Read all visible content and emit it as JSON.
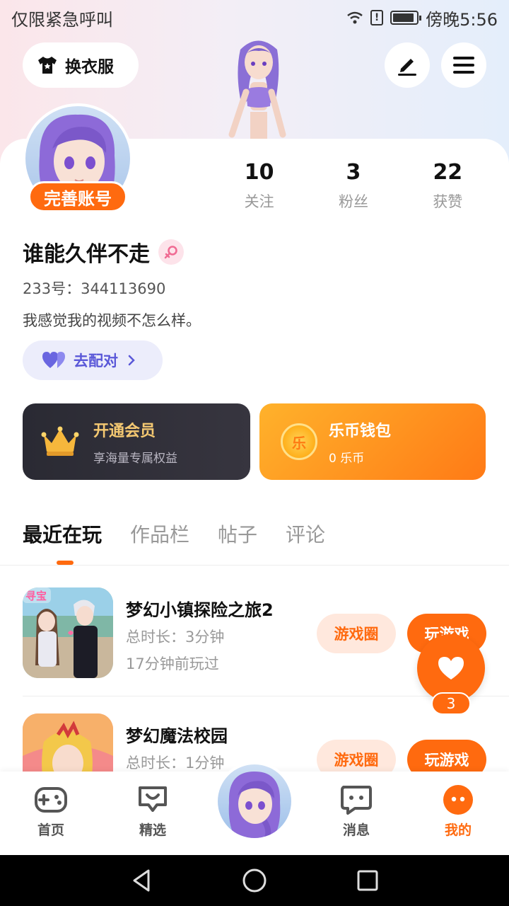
{
  "status_bar": {
    "left_text": "仅限紧急呼叫",
    "time": "傍晚5:56",
    "sim_mark": "!",
    "battery_level": 0.9
  },
  "header": {
    "outfit_label": "换衣服"
  },
  "profile": {
    "complete_badge": "完善账号",
    "stats": [
      {
        "value": "10",
        "label": "关注"
      },
      {
        "value": "3",
        "label": "粉丝"
      },
      {
        "value": "22",
        "label": "获赞"
      }
    ],
    "name": "谁能久伴不走",
    "uid": "233号：344113690",
    "bio": "我感觉我的视频不怎么样。",
    "match_label": "去配对"
  },
  "vip_card": {
    "title": "开通会员",
    "subtitle": "享海量专属权益"
  },
  "coin_card": {
    "icon_text": "乐",
    "title": "乐币钱包",
    "subtitle": "0 乐币"
  },
  "tabs": [
    "最近在玩",
    "作品栏",
    "帖子",
    "评论"
  ],
  "games": [
    {
      "title": "梦幻小镇探险之旅2",
      "duration": "总时长：3分钟",
      "last_played": "17分钟前玩过",
      "thumb_tag": "寻宝",
      "circle_label": "游戏圈",
      "play_label": "玩游戏"
    },
    {
      "title": "梦幻魔法校园",
      "duration": "总时长：1分钟",
      "circle_label": "游戏圈",
      "play_label": "玩游戏"
    }
  ],
  "like_fab": {
    "count": "3"
  },
  "bottom_nav": [
    {
      "label": "首页",
      "icon": "gamepad-icon"
    },
    {
      "label": "精选",
      "icon": "heart-chat-icon"
    },
    {
      "label": "消息",
      "icon": "message-icon"
    },
    {
      "label": "我的",
      "icon": "profile-dots-icon"
    }
  ],
  "colors": {
    "accent": "#ff6a0f",
    "vip_gold": "#f5c972",
    "match_purple": "#5a58d8"
  }
}
